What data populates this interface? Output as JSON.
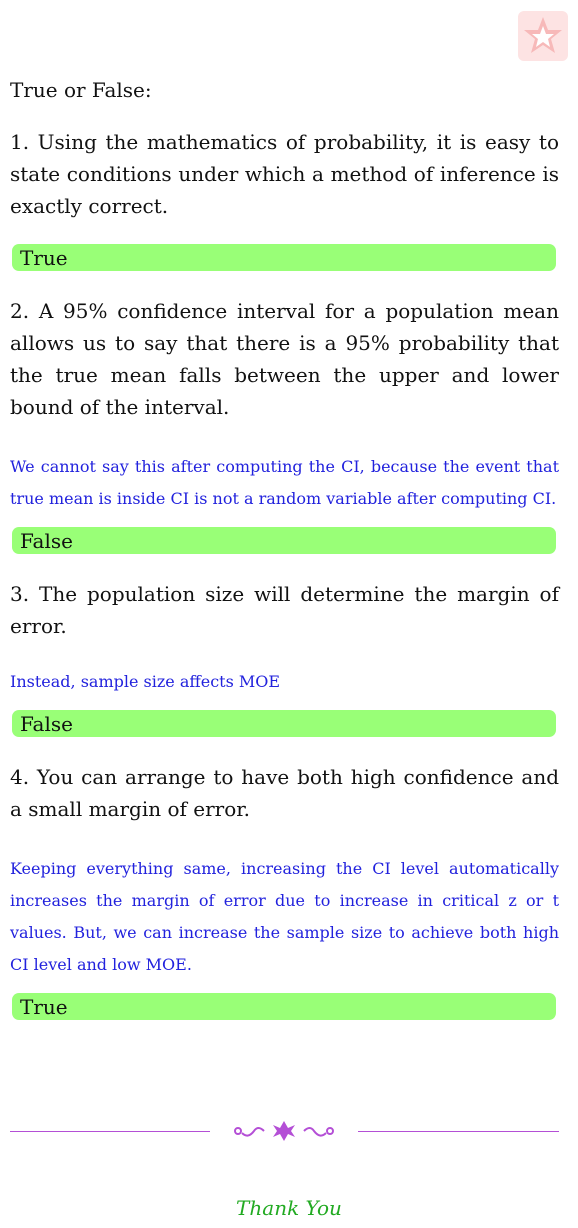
{
  "heading": "True or False:",
  "questions": [
    {
      "text": "1.  Using the mathematics of probability, it is easy to state conditions under which a method of inference is exactly correct.",
      "note": "",
      "answer": "True"
    },
    {
      "text": "2.  A 95% confidence interval for a population mean allows us to say that there is a 95% probability that the true mean falls between the upper and lower bound of the interval.",
      "note": "We cannot say this after computing the CI, because the event that true mean is inside CI is not a random variable after computing CI.",
      "answer": "False"
    },
    {
      "text": "3.  The population size will determine the margin of error.",
      "note": "Instead, sample size affects MOE",
      "answer": "False"
    },
    {
      "text": "4.  You can arrange to have both high confidence and a small margin of error.",
      "note": "Keeping everything same, increasing the CI level automatically increases the margin of error due to increase in critical z or t values. But, we can increase the sample size to achieve both high CI level and low MOE.",
      "answer": "True"
    }
  ],
  "footer": {
    "thanks": "Thank You"
  },
  "colors": {
    "answer_bg": "#99ff77",
    "note": "#2222dd",
    "ornament": "#b44fd6",
    "thanks": "#22aa22",
    "logo_bg": "#fde3e3"
  },
  "icons": {
    "logo": "star-logo-icon",
    "divider": "floral-ornament-icon"
  }
}
